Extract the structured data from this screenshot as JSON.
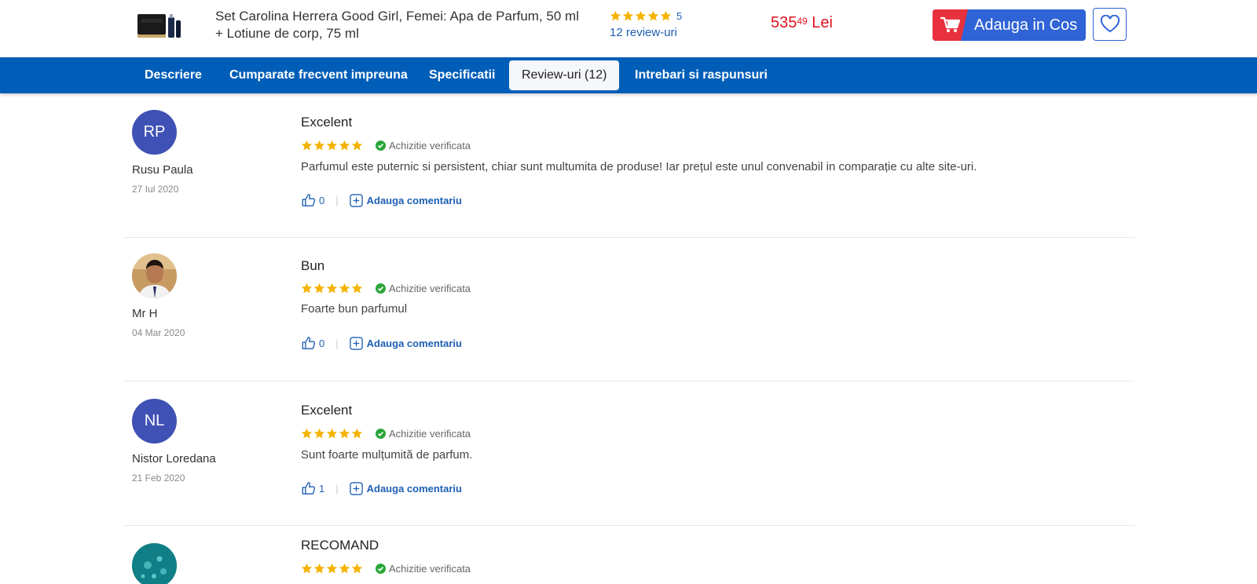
{
  "product": {
    "title": "Set Carolina Herrera Good Girl, Femei: Apa de Parfum, 50 ml + Lotiune de corp, 75 ml",
    "rating_value": "5",
    "reviews_link": "12 review-uri",
    "price_main": "535",
    "price_decimals": "49",
    "currency": "Lei",
    "add_to_cart": "Adauga in Cos"
  },
  "tabs": [
    {
      "label": "Descriere"
    },
    {
      "label": "Cumparate frecvent impreuna"
    },
    {
      "label": "Specificatii"
    },
    {
      "label": "Review-uri (12)"
    },
    {
      "label": "Intrebari si raspunsuri"
    }
  ],
  "colors": {
    "nav": "#005eb8",
    "accent": "#1e5fb4",
    "price": "#e0141e",
    "star": "#f5b301",
    "verified": "#2aa639",
    "avatar": "#3f51b5"
  },
  "reviews": [
    {
      "initials": "RP",
      "author": "Rusu Paula",
      "date": "27 Iul 2020",
      "title": "Excelent",
      "stars": 5,
      "verified": "Achizitie verificata",
      "text": "Parfumul este puternic si persistent, chiar sunt multumita de produse! Iar prețul este unul convenabil in comparație cu alte site-uri.",
      "likes": "0",
      "comment_label": "Adauga comentariu"
    },
    {
      "initials": "",
      "author": "Mr H",
      "date": "04 Mar 2020",
      "title": "Bun",
      "stars": 5,
      "verified": "Achizitie verificata",
      "text": "Foarte bun parfumul",
      "likes": "0",
      "comment_label": "Adauga comentariu"
    },
    {
      "initials": "NL",
      "author": "Nistor Loredana",
      "date": "21 Feb 2020",
      "title": "Excelent",
      "stars": 5,
      "verified": "Achizitie verificata",
      "text": "Sunt foarte mulțumită de parfum.",
      "likes": "1",
      "comment_label": "Adauga comentariu"
    },
    {
      "initials": "",
      "author": "",
      "date": "",
      "title": "RECOMAND",
      "stars": 5,
      "verified": "Achizitie verificata",
      "text": "",
      "likes": "",
      "comment_label": ""
    }
  ]
}
